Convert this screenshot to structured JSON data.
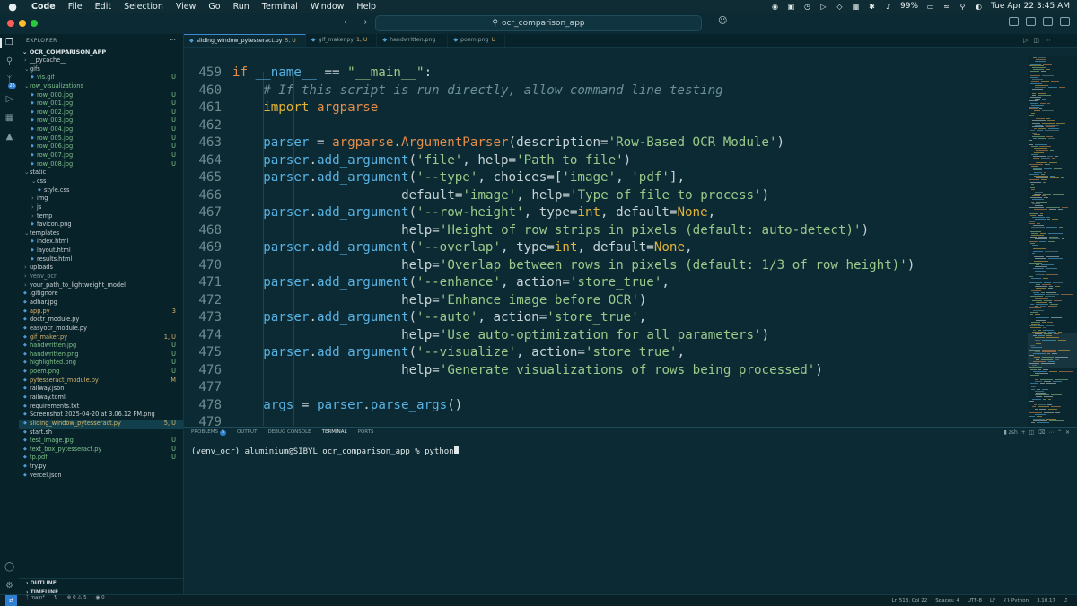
{
  "menubar": {
    "apple": "",
    "items": [
      "Code",
      "File",
      "Edit",
      "Selection",
      "View",
      "Go",
      "Run",
      "Terminal",
      "Window",
      "Help"
    ],
    "battery": "99%",
    "datetime": "Tue Apr 22  3:45 AM"
  },
  "titlebar": {
    "command_center": "ocr_comparison_app"
  },
  "activity": {
    "scm_badge": "26"
  },
  "explorer": {
    "header": "EXPLORER",
    "root": "OCR_COMPARISON_APP",
    "items": [
      {
        "label": "__pycache__",
        "status": "",
        "indent": 1,
        "type": "folder",
        "state": "closed",
        "color": "norm"
      },
      {
        "label": "gifs",
        "status": "",
        "indent": 1,
        "type": "folder",
        "state": "open",
        "color": "norm"
      },
      {
        "label": "vis.gif",
        "status": "U",
        "indent": 2,
        "type": "file",
        "color": "git"
      },
      {
        "label": "row_visualizations",
        "status": "",
        "indent": 1,
        "type": "folder",
        "state": "open",
        "color": "git"
      },
      {
        "label": "row_000.jpg",
        "status": "U",
        "indent": 2,
        "type": "file",
        "color": "git"
      },
      {
        "label": "row_001.jpg",
        "status": "U",
        "indent": 2,
        "type": "file",
        "color": "git"
      },
      {
        "label": "row_002.jpg",
        "status": "U",
        "indent": 2,
        "type": "file",
        "color": "git"
      },
      {
        "label": "row_003.jpg",
        "status": "U",
        "indent": 2,
        "type": "file",
        "color": "git"
      },
      {
        "label": "row_004.jpg",
        "status": "U",
        "indent": 2,
        "type": "file",
        "color": "git"
      },
      {
        "label": "row_005.jpg",
        "status": "U",
        "indent": 2,
        "type": "file",
        "color": "git"
      },
      {
        "label": "row_006.jpg",
        "status": "U",
        "indent": 2,
        "type": "file",
        "color": "git"
      },
      {
        "label": "row_007.jpg",
        "status": "U",
        "indent": 2,
        "type": "file",
        "color": "git"
      },
      {
        "label": "row_008.jpg",
        "status": "U",
        "indent": 2,
        "type": "file",
        "color": "git"
      },
      {
        "label": "static",
        "status": "",
        "indent": 1,
        "type": "folder",
        "state": "open",
        "color": "norm"
      },
      {
        "label": "css",
        "status": "",
        "indent": 2,
        "type": "folder",
        "state": "open",
        "color": "norm"
      },
      {
        "label": "style.css",
        "status": "",
        "indent": 3,
        "type": "file",
        "color": "norm"
      },
      {
        "label": "img",
        "status": "",
        "indent": 2,
        "type": "folder",
        "state": "closed",
        "color": "norm"
      },
      {
        "label": "js",
        "status": "",
        "indent": 2,
        "type": "folder",
        "state": "closed",
        "color": "norm"
      },
      {
        "label": "temp",
        "status": "",
        "indent": 2,
        "type": "folder",
        "state": "closed",
        "color": "norm"
      },
      {
        "label": "favicon.png",
        "status": "",
        "indent": 2,
        "type": "file",
        "color": "norm"
      },
      {
        "label": "templates",
        "status": "",
        "indent": 1,
        "type": "folder",
        "state": "open",
        "color": "norm"
      },
      {
        "label": "index.html",
        "status": "",
        "indent": 2,
        "type": "file",
        "color": "norm"
      },
      {
        "label": "layout.html",
        "status": "",
        "indent": 2,
        "type": "file",
        "color": "norm"
      },
      {
        "label": "results.html",
        "status": "",
        "indent": 2,
        "type": "file",
        "color": "norm"
      },
      {
        "label": "uploads",
        "status": "",
        "indent": 1,
        "type": "folder",
        "state": "closed",
        "color": "norm"
      },
      {
        "label": "venv_ocr",
        "status": "",
        "indent": 1,
        "type": "folder",
        "state": "closed",
        "color": "dim"
      },
      {
        "label": "your_path_to_lightweight_model",
        "status": "",
        "indent": 1,
        "type": "folder",
        "state": "closed",
        "color": "norm"
      },
      {
        "label": ".gitignore",
        "status": "",
        "indent": 1,
        "type": "file",
        "color": "norm"
      },
      {
        "label": "adhar.jpg",
        "status": "",
        "indent": 1,
        "type": "file",
        "color": "norm"
      },
      {
        "label": "app.py",
        "status": "3",
        "indent": 1,
        "type": "file",
        "color": "mod"
      },
      {
        "label": "doctr_module.py",
        "status": "",
        "indent": 1,
        "type": "file",
        "color": "norm"
      },
      {
        "label": "easyocr_module.py",
        "status": "",
        "indent": 1,
        "type": "file",
        "color": "norm"
      },
      {
        "label": "gif_maker.py",
        "status": "1, U",
        "indent": 1,
        "type": "file",
        "color": "mod"
      },
      {
        "label": "handwritten.jpg",
        "status": "U",
        "indent": 1,
        "type": "file",
        "color": "git"
      },
      {
        "label": "handwritten.png",
        "status": "U",
        "indent": 1,
        "type": "file",
        "color": "git"
      },
      {
        "label": "highlighted.png",
        "status": "U",
        "indent": 1,
        "type": "file",
        "color": "git"
      },
      {
        "label": "poem.png",
        "status": "U",
        "indent": 1,
        "type": "file",
        "color": "git"
      },
      {
        "label": "pytesseract_module.py",
        "status": "M",
        "indent": 1,
        "type": "file",
        "color": "mod"
      },
      {
        "label": "railway.json",
        "status": "",
        "indent": 1,
        "type": "file",
        "color": "norm"
      },
      {
        "label": "railway.toml",
        "status": "",
        "indent": 1,
        "type": "file",
        "color": "norm"
      },
      {
        "label": "requirements.txt",
        "status": "",
        "indent": 1,
        "type": "file",
        "color": "norm"
      },
      {
        "label": "Screenshot 2025-04-20 at 3.06.12 PM.png",
        "status": "",
        "indent": 1,
        "type": "file",
        "color": "norm"
      },
      {
        "label": "sliding_window_pytesseract.py",
        "status": "5, U",
        "indent": 1,
        "type": "file",
        "color": "mod",
        "selected": true
      },
      {
        "label": "start.sh",
        "status": "",
        "indent": 1,
        "type": "file",
        "color": "norm"
      },
      {
        "label": "test_image.jpg",
        "status": "U",
        "indent": 1,
        "type": "file",
        "color": "git"
      },
      {
        "label": "text_box_pytesseract.py",
        "status": "U",
        "indent": 1,
        "type": "file",
        "color": "git"
      },
      {
        "label": "tp.pdf",
        "status": "U",
        "indent": 1,
        "type": "file",
        "color": "git"
      },
      {
        "label": "try.py",
        "status": "",
        "indent": 1,
        "type": "file",
        "color": "norm"
      },
      {
        "label": "vercel.json",
        "status": "",
        "indent": 1,
        "type": "file",
        "color": "norm"
      }
    ],
    "outline": "OUTLINE",
    "timeline": "TIMELINE"
  },
  "tabs": [
    {
      "label": "sliding_window_pytesseract.py",
      "status": "5, U",
      "active": true
    },
    {
      "label": "gif_maker.py",
      "status": "1, U",
      "active": false
    },
    {
      "label": "handwritten.png",
      "status": "",
      "active": false
    },
    {
      "label": "poem.png",
      "status": "U",
      "active": false
    }
  ],
  "editor": {
    "lines": [
      {
        "n": "459",
        "indent": 0,
        "tokens": [
          [
            "kw",
            "if "
          ],
          [
            "dun",
            "__name__"
          ],
          [
            "op",
            " == "
          ],
          [
            "str",
            "\"__main__\""
          ],
          [
            "op",
            ":"
          ]
        ]
      },
      {
        "n": "460",
        "indent": 1,
        "tokens": [
          [
            "com",
            "# If this script is run directly, allow command line testing"
          ]
        ]
      },
      {
        "n": "461",
        "indent": 1,
        "tokens": [
          [
            "imp",
            "import "
          ],
          [
            "fn",
            "argparse"
          ]
        ]
      },
      {
        "n": "462",
        "indent": 0,
        "tokens": []
      },
      {
        "n": "463",
        "indent": 1,
        "tokens": [
          [
            "id",
            "parser"
          ],
          [
            "op",
            " = "
          ],
          [
            "fn",
            "argparse"
          ],
          [
            "op",
            "."
          ],
          [
            "fn",
            "ArgumentParser"
          ],
          [
            "op",
            "(description="
          ],
          [
            "str",
            "'Row-Based OCR Module'"
          ],
          [
            "op",
            ")"
          ]
        ]
      },
      {
        "n": "464",
        "indent": 1,
        "tokens": [
          [
            "id",
            "parser"
          ],
          [
            "op",
            "."
          ],
          [
            "id",
            "add_argument"
          ],
          [
            "op",
            "("
          ],
          [
            "str",
            "'file'"
          ],
          [
            "op",
            ", help="
          ],
          [
            "str",
            "'Path to file'"
          ],
          [
            "op",
            ")"
          ]
        ]
      },
      {
        "n": "465",
        "indent": 1,
        "tokens": [
          [
            "id",
            "parser"
          ],
          [
            "op",
            "."
          ],
          [
            "id",
            "add_argument"
          ],
          [
            "op",
            "("
          ],
          [
            "str",
            "'--type'"
          ],
          [
            "op",
            ", choices=["
          ],
          [
            "str",
            "'image'"
          ],
          [
            "op",
            ", "
          ],
          [
            "str",
            "'pdf'"
          ],
          [
            "op",
            "],"
          ]
        ]
      },
      {
        "n": "466",
        "indent": 6,
        "tokens": [
          [
            "op",
            "default="
          ],
          [
            "str",
            "'image'"
          ],
          [
            "op",
            ", help="
          ],
          [
            "str",
            "'Type of file to process'"
          ],
          [
            "op",
            ")"
          ]
        ]
      },
      {
        "n": "467",
        "indent": 1,
        "tokens": [
          [
            "id",
            "parser"
          ],
          [
            "op",
            "."
          ],
          [
            "id",
            "add_argument"
          ],
          [
            "op",
            "("
          ],
          [
            "str",
            "'--row-height'"
          ],
          [
            "op",
            ", type="
          ],
          [
            "num",
            "int"
          ],
          [
            "op",
            ", default="
          ],
          [
            "num",
            "None"
          ],
          [
            "op",
            ","
          ]
        ]
      },
      {
        "n": "468",
        "indent": 6,
        "tokens": [
          [
            "op",
            "help="
          ],
          [
            "str",
            "'Height of row strips in pixels (default: auto-detect)'"
          ],
          [
            "op",
            ")"
          ]
        ]
      },
      {
        "n": "469",
        "indent": 1,
        "tokens": [
          [
            "id",
            "parser"
          ],
          [
            "op",
            "."
          ],
          [
            "id",
            "add_argument"
          ],
          [
            "op",
            "("
          ],
          [
            "str",
            "'--overlap'"
          ],
          [
            "op",
            ", type="
          ],
          [
            "num",
            "int"
          ],
          [
            "op",
            ", default="
          ],
          [
            "num",
            "None"
          ],
          [
            "op",
            ","
          ]
        ]
      },
      {
        "n": "470",
        "indent": 6,
        "tokens": [
          [
            "op",
            "help="
          ],
          [
            "str",
            "'Overlap between rows in pixels (default: 1/3 of row height)'"
          ],
          [
            "op",
            ")"
          ]
        ]
      },
      {
        "n": "471",
        "indent": 1,
        "tokens": [
          [
            "id",
            "parser"
          ],
          [
            "op",
            "."
          ],
          [
            "id",
            "add_argument"
          ],
          [
            "op",
            "("
          ],
          [
            "str",
            "'--enhance'"
          ],
          [
            "op",
            ", action="
          ],
          [
            "str",
            "'store_true'"
          ],
          [
            "op",
            ","
          ]
        ]
      },
      {
        "n": "472",
        "indent": 6,
        "tokens": [
          [
            "op",
            "help="
          ],
          [
            "str",
            "'Enhance image before OCR'"
          ],
          [
            "op",
            ")"
          ]
        ]
      },
      {
        "n": "473",
        "indent": 1,
        "tokens": [
          [
            "id",
            "parser"
          ],
          [
            "op",
            "."
          ],
          [
            "id",
            "add_argument"
          ],
          [
            "op",
            "("
          ],
          [
            "str",
            "'--auto'"
          ],
          [
            "op",
            ", action="
          ],
          [
            "str",
            "'store_true'"
          ],
          [
            "op",
            ","
          ]
        ]
      },
      {
        "n": "474",
        "indent": 6,
        "tokens": [
          [
            "op",
            "help="
          ],
          [
            "str",
            "'Use auto-optimization for all parameters'"
          ],
          [
            "op",
            ")"
          ]
        ]
      },
      {
        "n": "475",
        "indent": 1,
        "tokens": [
          [
            "id",
            "parser"
          ],
          [
            "op",
            "."
          ],
          [
            "id",
            "add_argument"
          ],
          [
            "op",
            "("
          ],
          [
            "str",
            "'--visualize'"
          ],
          [
            "op",
            ", action="
          ],
          [
            "str",
            "'store_true'"
          ],
          [
            "op",
            ","
          ]
        ]
      },
      {
        "n": "476",
        "indent": 6,
        "tokens": [
          [
            "op",
            "help="
          ],
          [
            "str",
            "'Generate visualizations of rows being processed'"
          ],
          [
            "op",
            ")"
          ]
        ]
      },
      {
        "n": "477",
        "indent": 0,
        "tokens": []
      },
      {
        "n": "478",
        "indent": 1,
        "tokens": [
          [
            "id",
            "args"
          ],
          [
            "op",
            " = "
          ],
          [
            "id",
            "parser"
          ],
          [
            "op",
            "."
          ],
          [
            "id",
            "parse_args"
          ],
          [
            "op",
            "()"
          ]
        ]
      },
      {
        "n": "479",
        "indent": 0,
        "tokens": []
      }
    ]
  },
  "panel": {
    "tabs": [
      "PROBLEMS",
      "OUTPUT",
      "DEBUG CONSOLE",
      "TERMINAL",
      "PORTS"
    ],
    "problems_badge": "5",
    "active": "TERMINAL",
    "shell": "zsh",
    "prompt": "(venv_ocr) aluminium@SIBYL ocr_comparison_app % python"
  },
  "statusbar": {
    "branch": "main*",
    "position": "Ln 513, Col 22",
    "spaces": "Spaces: 4",
    "encoding": "UTF-8",
    "eol": "LF",
    "language": "Python",
    "version": "3.10.17"
  },
  "colors": {
    "background": "#0b2a33",
    "accent": "#2f7fd1",
    "git_untracked": "#7ec28a",
    "git_modified": "#d5b36b"
  }
}
